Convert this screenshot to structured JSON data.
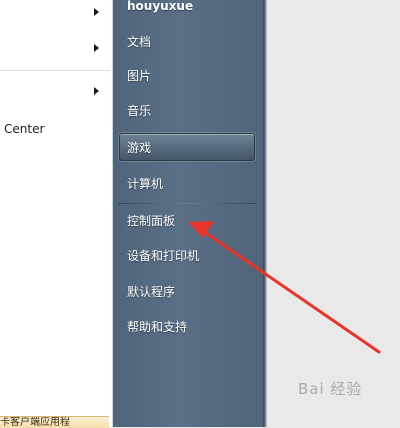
{
  "left_list": {
    "partial_text": "Center",
    "tooltip_text": "卡客户端应用程"
  },
  "right_menu": {
    "user_name": "houyuxue",
    "items": [
      "文档",
      "图片",
      "音乐",
      "游戏",
      "计算机",
      "控制面板",
      "设备和打印机",
      "默认程序",
      "帮助和支持"
    ],
    "highlighted_item": "游戏"
  },
  "annotation": {
    "arrow_points_to": "控制面板",
    "arrow_color": "#e8342a"
  },
  "watermark": {
    "text": "Bai 经验"
  },
  "colors": {
    "menu_panel": "#5a6f86",
    "menu_text": "#ffffff",
    "left_panel": "#ffffff"
  }
}
